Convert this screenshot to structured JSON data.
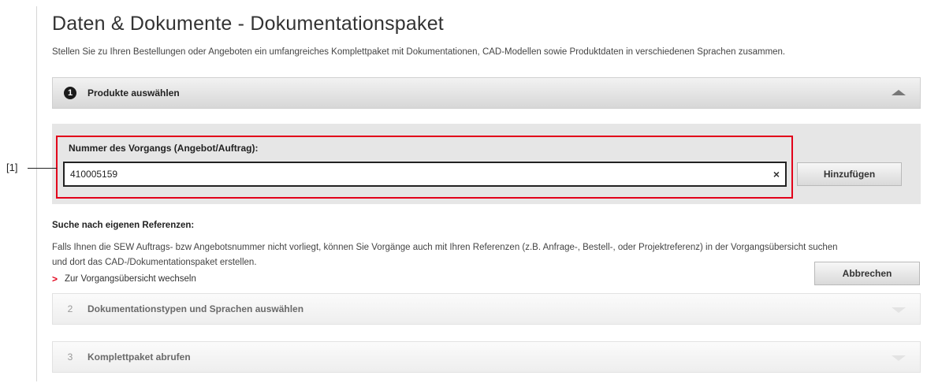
{
  "page": {
    "title": "Daten & Dokumente - Dokumentationspaket",
    "intro": "Stellen Sie zu Ihren Bestellungen oder Angeboten ein umfangreiches Komplettpaket mit Dokumentationen, CAD-Modellen sowie Produktdaten in verschiedenen Sprachen zusammen."
  },
  "steps": [
    {
      "number": "1",
      "title": "Produkte auswählen",
      "state": "expanded"
    },
    {
      "number": "2",
      "title": "Dokumentationstypen und Sprachen auswählen",
      "state": "collapsed"
    },
    {
      "number": "3",
      "title": "Komplettpaket abrufen",
      "state": "collapsed"
    }
  ],
  "order_field": {
    "label": "Nummer des Vorgangs (Angebot/Auftrag):",
    "value": "410005159",
    "clear_glyph": "×",
    "add_label": "Hinzufügen"
  },
  "callout": {
    "label": "[1]"
  },
  "references": {
    "title": "Suche nach eigenen Referenzen:",
    "text": "Falls Ihnen die SEW Auftrags- bzw Angebotsnummer nicht vorliegt, können Sie Vorgänge auch mit Ihren Referenzen (z.B. Anfrage-, Bestell-, oder Projektreferenz) in der Vorgangsübersicht suchen und dort das CAD-/Dokumentationspaket erstellen.",
    "link_glyph": ">",
    "link_label": "Zur Vorgangsübersicht wechseln",
    "cancel_label": "Abbrechen"
  },
  "colors": {
    "accent_red": "#e2001a",
    "panel_gray": "#e6e6e6"
  },
  "icons": {
    "expanded_toggle": "triangle-up",
    "collapsed_toggle": "triangle-down",
    "clear": "close-x",
    "link": "chevron-right"
  }
}
